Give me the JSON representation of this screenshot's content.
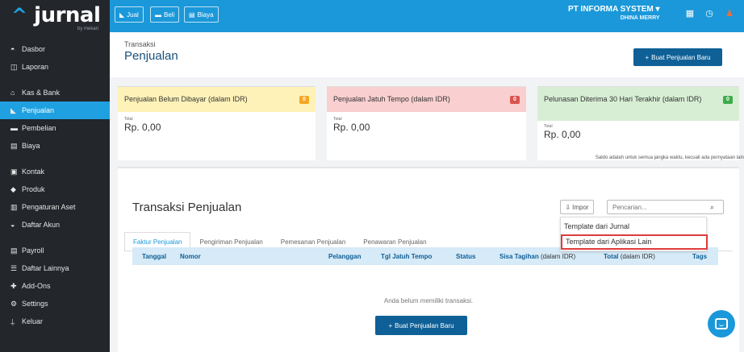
{
  "logo": {
    "text": "jurnal",
    "caret": "^",
    "sub": "by mekari"
  },
  "sidebar": {
    "items": [
      {
        "label": "Dasbor",
        "icon": "dashboard-icon",
        "glyph": "◓"
      },
      {
        "label": "Laporan",
        "icon": "report-icon",
        "glyph": "◫"
      },
      {
        "label": "Kas & Bank",
        "icon": "bank-icon",
        "glyph": "⌂"
      },
      {
        "label": "Penjualan",
        "icon": "sales-tag-icon",
        "glyph": "◣",
        "active": true
      },
      {
        "label": "Pembelian",
        "icon": "purchase-card-icon",
        "glyph": "▬"
      },
      {
        "label": "Biaya",
        "icon": "expense-doc-icon",
        "glyph": "▤"
      },
      {
        "label": "Kontak",
        "icon": "contact-icon",
        "glyph": "▣"
      },
      {
        "label": "Produk",
        "icon": "product-icon",
        "glyph": "◆"
      },
      {
        "label": "Pengaturan Aset",
        "icon": "asset-icon",
        "glyph": "▥"
      },
      {
        "label": "Daftar Akun",
        "icon": "account-icon",
        "glyph": "◒"
      },
      {
        "label": "Payroll",
        "icon": "payroll-icon",
        "glyph": "▤"
      },
      {
        "label": "Daftar Lainnya",
        "icon": "list-icon",
        "glyph": "☰"
      },
      {
        "label": "Add-Ons",
        "icon": "puzzle-icon",
        "glyph": "✚"
      },
      {
        "label": "Settings",
        "icon": "settings-icon",
        "glyph": "⚙"
      },
      {
        "label": "Keluar",
        "icon": "logout-icon",
        "glyph": "⍊"
      }
    ]
  },
  "topbar": {
    "jual": "Jual",
    "beli": "Beli",
    "biaya": "Biaya",
    "company": "PT INFORMA SYSTEM",
    "company_caret": "▾",
    "user": "DHINA MERRY"
  },
  "header": {
    "breadcrumb": "Transaksi",
    "title": "Penjualan",
    "new_button": "Buat Penjualan Baru",
    "plus": "+"
  },
  "cards": [
    {
      "title": "Penjualan Belum Dibayar (dalam IDR)",
      "count": "0",
      "total_label": "Total",
      "amount": "Rp. 0,00"
    },
    {
      "title": "Penjualan Jatuh Tempo (dalam IDR)",
      "count": "0",
      "total_label": "Total",
      "amount": "Rp. 0,00"
    },
    {
      "title": "Pelunasan Diterima 30 Hari Terakhir (dalam IDR)",
      "count": "0",
      "total_label": "Total",
      "amount": "Rp. 0,00"
    }
  ],
  "saldo_note": "Saldo adalah untuk semua jangka waktu, kecuali ada pernyataan lain",
  "panel": {
    "title": "Transaksi Penjualan",
    "import_label": "Impor",
    "search_placeholder": "Pencarian...",
    "import_menu": [
      "Template dari Jurnal",
      "Template dari Aplikasi Lain"
    ],
    "tabs": [
      "Faktur Penjualan",
      "Pengiriman Penjualan",
      "Pemesanan Penjualan",
      "Penawaran Penjualan"
    ],
    "columns": {
      "tanggal": "Tanggal",
      "nomor": "Nomor",
      "pelanggan": "Pelanggan",
      "jatuh_tempo": "Tgl Jatuh Tempo",
      "status": "Status",
      "sisa": "Sisa Tagihan",
      "sisa_unit": "(dalam IDR)",
      "total": "Total",
      "total_unit": "(dalam IDR)",
      "tags": "Tags"
    },
    "empty": "Anda belum memiliki transaksi.",
    "new_button": "Buat Penjualan Baru"
  },
  "colors": {
    "primary": "#1b98d9",
    "sidebar": "#23262b",
    "button": "#0e6097",
    "highlight": "#e03b3b"
  }
}
